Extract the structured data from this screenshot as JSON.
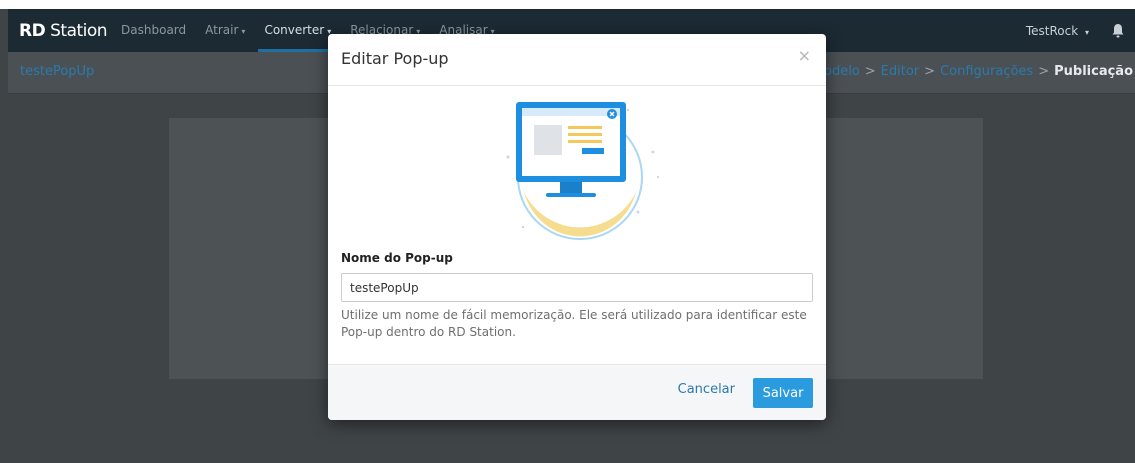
{
  "navbar": {
    "brand_bold": "RD",
    "brand_rest": " Station",
    "items": [
      {
        "label": "Dashboard",
        "caret": ""
      },
      {
        "label": "Atrair",
        "caret": "▾"
      },
      {
        "label": "Converter",
        "caret": "▾"
      },
      {
        "label": "Relacionar",
        "caret": "▾"
      },
      {
        "label": "Analisar",
        "caret": "▾"
      }
    ],
    "active_item": "Converter",
    "user": "TestRock",
    "user_caret": "▾",
    "bell_icon": "bell-icon"
  },
  "subbar": {
    "page_name": "testePopUp",
    "steps": [
      "odelo",
      "Editor",
      "Configurações",
      "Publicação"
    ],
    "separator": ">",
    "current_step": "Publicação"
  },
  "modal": {
    "title": "Editar Pop-up",
    "close": "×",
    "illustration_icon": "monitor-popup-illustration",
    "field_label": "Nome do Pop-up",
    "field_value": "testePopUp",
    "help_text": "Utilize um nome de fácil memorização. Ele será utilizado para identificar este Pop-up dentro do RD Station.",
    "cancel_label": "Cancelar",
    "save_label": "Salvar"
  },
  "colors": {
    "navbar_bg": "#1c2a34",
    "accent_blue": "#2b9be0",
    "link_blue": "#2b7aab",
    "overlay": "#3f4447"
  }
}
